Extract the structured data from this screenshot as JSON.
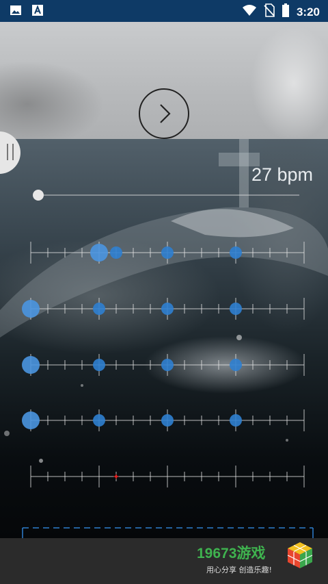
{
  "status_bar": {
    "time": "3:20",
    "icons": [
      "image-icon",
      "text-a-icon",
      "wifi-icon",
      "no-sim-icon",
      "battery-icon"
    ]
  },
  "top_panel": {
    "next_icon": "chevron-right-icon"
  },
  "tempo": {
    "label": "27 bpm",
    "slider_fraction": 0.0
  },
  "beat_grid": {
    "rows": [
      {
        "markers": [
          {
            "step": 4,
            "size": "large"
          },
          {
            "step": 5,
            "size": "small"
          },
          {
            "step": 8,
            "size": "small"
          },
          {
            "step": 12,
            "size": "small"
          }
        ]
      },
      {
        "markers": [
          {
            "step": 0,
            "size": "large"
          },
          {
            "step": 4,
            "size": "small"
          },
          {
            "step": 8,
            "size": "small"
          },
          {
            "step": 12,
            "size": "small"
          }
        ]
      },
      {
        "markers": [
          {
            "step": 0,
            "size": "large"
          },
          {
            "step": 4,
            "size": "small"
          },
          {
            "step": 8,
            "size": "small"
          },
          {
            "step": 12,
            "size": "small"
          }
        ]
      },
      {
        "markers": [
          {
            "step": 0,
            "size": "large"
          },
          {
            "step": 4,
            "size": "small"
          },
          {
            "step": 8,
            "size": "small"
          },
          {
            "step": 12,
            "size": "small"
          }
        ]
      },
      {
        "markers": [
          {
            "step": 5,
            "size": "tiny-red"
          }
        ]
      }
    ],
    "steps": 16
  },
  "colors": {
    "accent": "#2f7fd0",
    "accent_light": "#4a95e0",
    "status_bar": "#0e3a66",
    "red_marker": "#e02020",
    "dashed_line": "#2f7fd0"
  },
  "banner": {
    "brand_name": "19673游戏",
    "tagline": "用心分享  创造乐趣!"
  }
}
